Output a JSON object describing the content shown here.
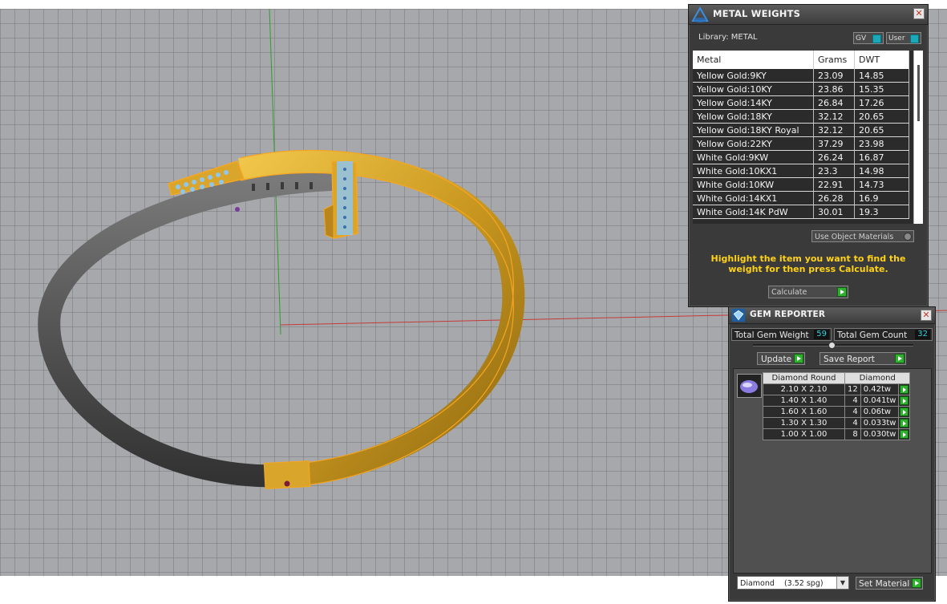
{
  "metal_weights": {
    "title": "METAL WEIGHTS",
    "library_label": "Library: METAL",
    "gv_label": "GV",
    "user_label": "User",
    "columns": [
      "Metal",
      "Grams",
      "DWT"
    ],
    "rows": [
      [
        "Yellow Gold:9KY",
        "23.09",
        "14.85"
      ],
      [
        "Yellow Gold:10KY",
        "23.86",
        "15.35"
      ],
      [
        "Yellow Gold:14KY",
        "26.84",
        "17.26"
      ],
      [
        "Yellow Gold:18KY",
        "32.12",
        "20.65"
      ],
      [
        "Yellow Gold:18KY Royal",
        "32.12",
        "20.65"
      ],
      [
        "Yellow Gold:22KY",
        "37.29",
        "23.98"
      ],
      [
        "White Gold:9KW",
        "26.24",
        "16.87"
      ],
      [
        "White Gold:10KX1",
        "23.3",
        "14.98"
      ],
      [
        "White Gold:10KW",
        "22.91",
        "14.73"
      ],
      [
        "White Gold:14KX1",
        "26.28",
        "16.9"
      ],
      [
        "White Gold:14K PdW",
        "30.01",
        "19.3"
      ]
    ],
    "use_object_materials": "Use Object Materials",
    "hint": "Highlight the item you want to find the weight for then press Calculate.",
    "calculate_label": "Calculate"
  },
  "gem_reporter": {
    "title": "GEM REPORTER",
    "total_weight_label": "Total Gem Weight",
    "total_weight_value": "59",
    "total_count_label": "Total Gem Count",
    "total_count_value": "32",
    "update_label": "Update",
    "save_report_label": "Save Report",
    "table_headers": [
      "Diamond Round",
      "Diamond"
    ],
    "gems": [
      {
        "size": "2.10 X 2.10",
        "count": "12",
        "weight": "0.42tw"
      },
      {
        "size": "1.40 X 1.40",
        "count": "4",
        "weight": "0.041tw"
      },
      {
        "size": "1.60 X 1.60",
        "count": "4",
        "weight": "0.06tw"
      },
      {
        "size": "1.30 X 1.30",
        "count": "4",
        "weight": "0.033tw"
      },
      {
        "size": "1.00 X 1.00",
        "count": "8",
        "weight": "0.030tw"
      }
    ],
    "material_select": "Diamond    (3.52 spg)",
    "set_material_label": "Set Material"
  },
  "colors": {
    "viewport_bg": "#a6a8ab",
    "gold": "#d9a52a",
    "gem_blue": "#8fc6ee",
    "accent_yellow": "#ffd21a",
    "axis_green": "#2e9e2e",
    "axis_red": "#c63a3a"
  }
}
